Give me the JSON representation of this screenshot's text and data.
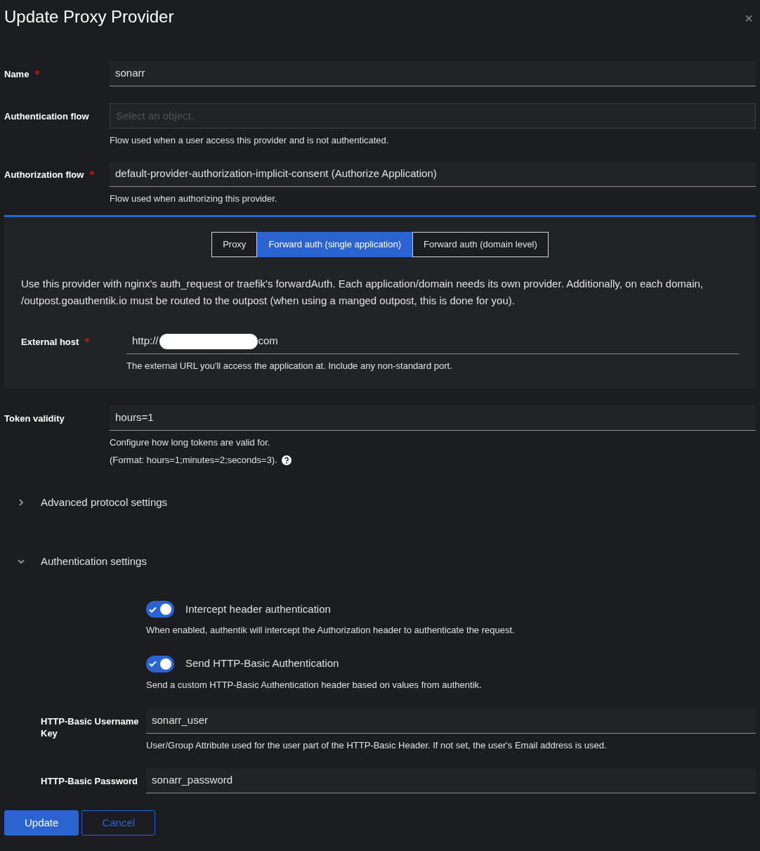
{
  "dialog": {
    "title": "Update Proxy Provider",
    "close": "×"
  },
  "fields": [
    {
      "label": "Name",
      "required": true,
      "value": "sonarr"
    },
    {
      "label": "Authentication flow",
      "required": false,
      "placeholder": "Select an object.",
      "help": [
        "Flow used when a user access this provider and is not authenticated."
      ]
    },
    {
      "label": "Authorization flow",
      "required": true,
      "value": "default-provider-authorization-implicit-consent (Authorize Application)",
      "help": [
        "Flow used when authorizing this provider."
      ]
    }
  ],
  "mode_panel": {
    "tabs": [
      {
        "label": "Proxy",
        "selected": false
      },
      {
        "label": "Forward auth (single application)",
        "selected": true
      },
      {
        "label": "Forward auth (domain level)",
        "selected": false
      }
    ],
    "description": "Use this provider with nginx's auth_request or traefik's forwardAuth. Each application/domain needs its own provider. Additionally, on each domain, /outpost.goauthentik.io must be routed to the outpost (when using a manged outpost, this is done for you).",
    "field": {
      "label": "External host",
      "required": true,
      "value_start": "http://",
      "redacted": true,
      "value_end": "com",
      "help": [
        "The external URL you'll access the application at. Include any non-standard port."
      ]
    }
  },
  "token_validity": {
    "label": "Token validity",
    "required": false,
    "value": "hours=1",
    "help": [
      "Configure how long tokens are valid for.",
      "(Format: hours=1;minutes=2;seconds=3)."
    ],
    "help_icon": true
  },
  "sections": [
    {
      "title": "Advanced protocol settings",
      "expanded": false
    },
    {
      "title": "Authentication settings",
      "expanded": true,
      "toggles": [
        {
          "label": "Intercept header authentication",
          "on": true,
          "help": "When enabled, authentik will intercept the Authorization header to authenticate the request."
        },
        {
          "label": "Send HTTP-Basic Authentication",
          "on": true,
          "help": "Send a custom HTTP-Basic Authentication header based on values from authentik."
        }
      ],
      "fields": [
        {
          "label": "HTTP-Basic Username Key",
          "required": false,
          "value": "sonarr_user",
          "help": [
            "User/Group Attribute used for the user part of the HTTP-Basic Header. If not set, the user's Email address is used."
          ]
        },
        {
          "label": "HTTP-Basic Password",
          "required": false,
          "value": "sonarr_password"
        }
      ]
    }
  ],
  "buttons": [
    {
      "label": "Update",
      "kind": "primary"
    },
    {
      "label": "Cancel",
      "kind": "secondary"
    }
  ]
}
